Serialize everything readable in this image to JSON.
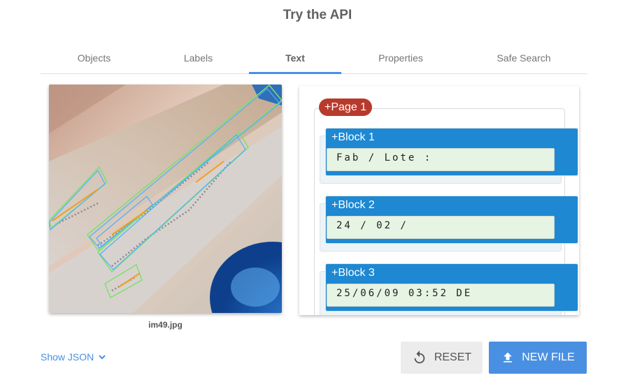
{
  "header": {
    "title": "Try the API"
  },
  "tabs": [
    {
      "label": "Objects",
      "active": false
    },
    {
      "label": "Labels",
      "active": false
    },
    {
      "label": "Text",
      "active": true
    },
    {
      "label": "Properties",
      "active": false
    },
    {
      "label": "Safe Search",
      "active": false
    }
  ],
  "image": {
    "filename": "im49.jpg"
  },
  "results": {
    "page_label": "+Page 1",
    "blocks": [
      {
        "label": "+Block 1",
        "text": "Fab / Lote :"
      },
      {
        "label": "+Block 2",
        "text": "24 / 02 /"
      },
      {
        "label": "+Block 3",
        "text": "25/06/09 03:52 DE"
      }
    ]
  },
  "footer": {
    "show_json_label": "Show JSON",
    "reset_label": "RESET",
    "new_file_label": "NEW FILE"
  },
  "colors": {
    "accent": "#4a90e2",
    "page_pill": "#b83a2c",
    "block_pill": "#1e88d2",
    "box_outline_green": "#7ee06a",
    "box_outline_blue": "#4fb0ff",
    "word_underline": "#f0a020"
  },
  "icons": {
    "show_json": "chevron-down-icon",
    "reset": "refresh-icon",
    "new_file": "upload-icon"
  }
}
